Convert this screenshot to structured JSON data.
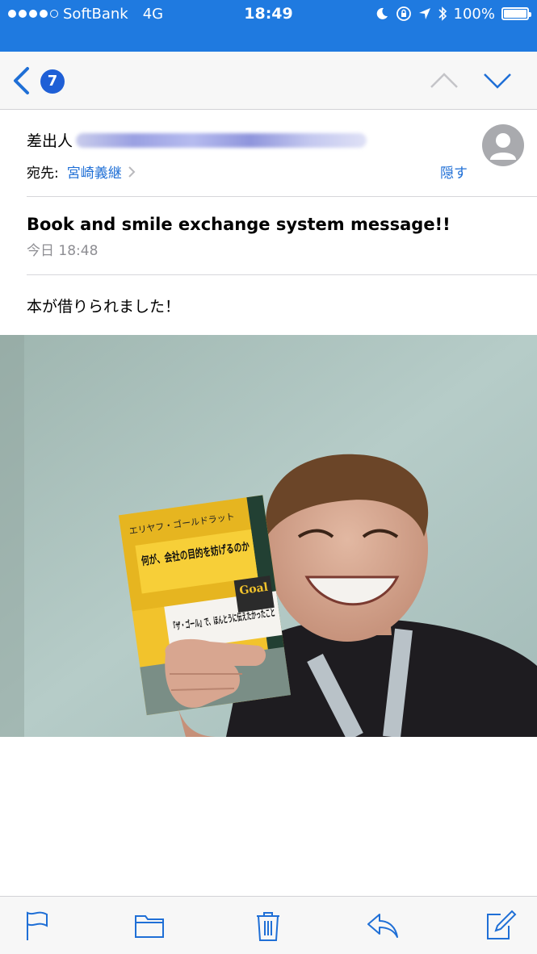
{
  "status_bar": {
    "carrier": "SoftBank",
    "network": "4G",
    "time": "18:49",
    "battery": "100%",
    "icons": [
      "moon-icon",
      "rotation-lock-icon",
      "location-icon",
      "bluetooth-icon",
      "battery-icon"
    ]
  },
  "nav": {
    "unread_count": "7",
    "icons": [
      "chevron-left-icon",
      "chevron-up-icon",
      "chevron-down-icon"
    ]
  },
  "header": {
    "from_label": "差出人",
    "to_label": "宛先:",
    "to_name": "宮崎義継",
    "hide_label": "隠す"
  },
  "message": {
    "subject": "Book and smile exchange system message!!",
    "date": "今日 18:48",
    "body": "本が借りられました！"
  },
  "photo": {
    "book_author": "エリヤフ・ゴールドラット",
    "book_title": "何が、会社の目的を妨げるのか",
    "book_band": "『ザ・ゴール』で、ほんとうに伝えたかったこと",
    "book_badge": "Goal"
  },
  "toolbar": {
    "icons": [
      "flag-icon",
      "folder-icon",
      "trash-icon",
      "reply-icon",
      "compose-icon"
    ]
  },
  "colors": {
    "status_bar": "#1f7ae0",
    "link": "#1f6fd6",
    "badge": "#1f5fd6"
  }
}
